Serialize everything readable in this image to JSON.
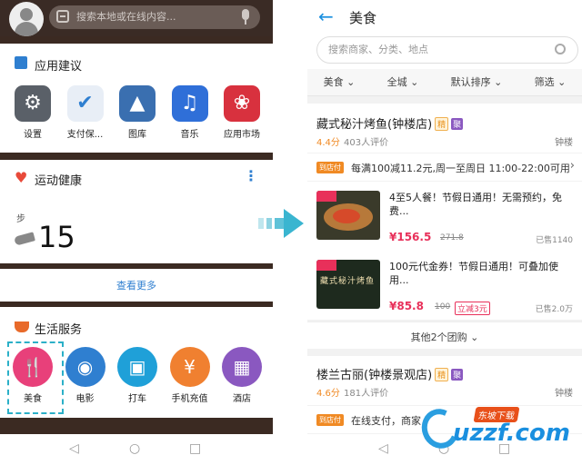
{
  "left": {
    "search_placeholder": "搜索本地或在线内容...",
    "app_section": {
      "title": "应用建议",
      "apps": [
        {
          "label": "设置",
          "icon": "settings-gear-icon",
          "color": "#5a6068"
        },
        {
          "label": "支付保...",
          "icon": "payment-shield-icon",
          "color": "#2f7fd0"
        },
        {
          "label": "图库",
          "icon": "gallery-icon",
          "color": "#3a6fb0"
        },
        {
          "label": "音乐",
          "icon": "music-note-icon",
          "color": "#2f6fd8"
        },
        {
          "label": "应用市场",
          "icon": "app-market-icon",
          "color": "#d8313e"
        }
      ]
    },
    "health": {
      "title": "运动健康",
      "step_label": "步",
      "step_count": "15"
    },
    "more_label": "查看更多",
    "life": {
      "title": "生活服务",
      "services": [
        {
          "label": "美食",
          "icon": "fork-knife-icon",
          "color": "#e8407a"
        },
        {
          "label": "电影",
          "icon": "film-reel-icon",
          "color": "#2f7fd0"
        },
        {
          "label": "打车",
          "icon": "taxi-icon",
          "color": "#1fa0d8"
        },
        {
          "label": "手机充值",
          "icon": "recharge-icon",
          "color": "#f08030"
        },
        {
          "label": "酒店",
          "icon": "hotel-icon",
          "color": "#8a58c0"
        }
      ]
    }
  },
  "right": {
    "title": "美食",
    "search_placeholder": "搜索商家、分类、地点",
    "filters": [
      "美食",
      "全城",
      "默认排序",
      "筛选"
    ],
    "shop1": {
      "name": "藏式秘汁烤鱼(钟楼店)",
      "tag1": "精",
      "tag2": "聚",
      "score": "4.4分",
      "reviews": "403人评价",
      "area": "钟楼",
      "store_tag": "到店付",
      "promo": "每满100减11.2元,周一至周日 11:00-22:00可用",
      "deals": [
        {
          "title": "4至5人餐！节假日通用！无需预约，免费...",
          "price": "¥156.5",
          "old_price": "271.8",
          "extra": "",
          "sold": "已售1140"
        },
        {
          "title": "100元代金券！节假日通用！可叠加使用...",
          "price": "¥85.8",
          "old_price": "100",
          "extra": "立减3元",
          "sold": "已售2.0万"
        }
      ],
      "thumb2_text": "藏式秘汁烤鱼",
      "more_deals": "其他2个团购"
    },
    "shop2": {
      "name": "楼兰古丽(钟楼景观店)",
      "tag1": "精",
      "tag2": "聚",
      "score": "4.6分",
      "reviews": "181人评价",
      "area": "钟楼",
      "store_tag": "到店付",
      "promo": "在线支付，商家"
    }
  },
  "watermark": {
    "brand": "uzzf.com",
    "tagline": "东坡下载"
  },
  "colors": {
    "accent_blue": "#1a8fdf",
    "price_red": "#e8305a",
    "orange": "#f08a24",
    "arrow": "#3ab5d0"
  }
}
